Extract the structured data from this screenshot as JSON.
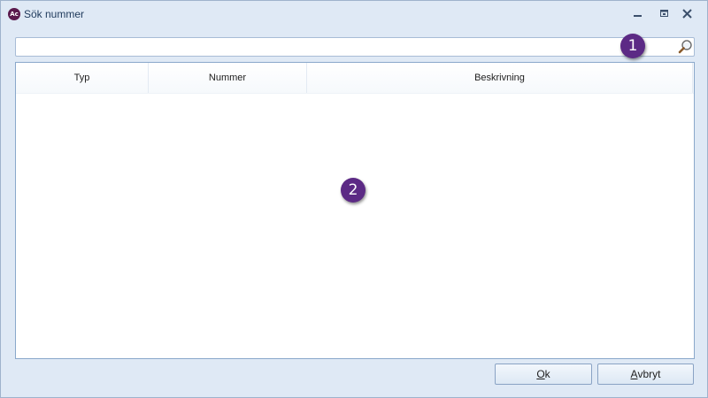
{
  "window": {
    "title": "Sök nummer",
    "app_icon_text": "Ac",
    "controls": [
      "minimize",
      "maximize",
      "close"
    ]
  },
  "search": {
    "value": "",
    "placeholder": "",
    "icon": "search-icon"
  },
  "grid": {
    "columns": [
      "Typ",
      "Nummer",
      "Beskrivning"
    ],
    "rows": []
  },
  "callouts": [
    "1",
    "2"
  ],
  "buttons": {
    "ok_underline": "O",
    "ok_rest": "k",
    "cancel_underline": "A",
    "cancel_rest": "vbryt"
  },
  "colors": {
    "accent_callout": "#5c2a85",
    "window_background": "#dfe9f5",
    "border": "#8aa8cb"
  }
}
